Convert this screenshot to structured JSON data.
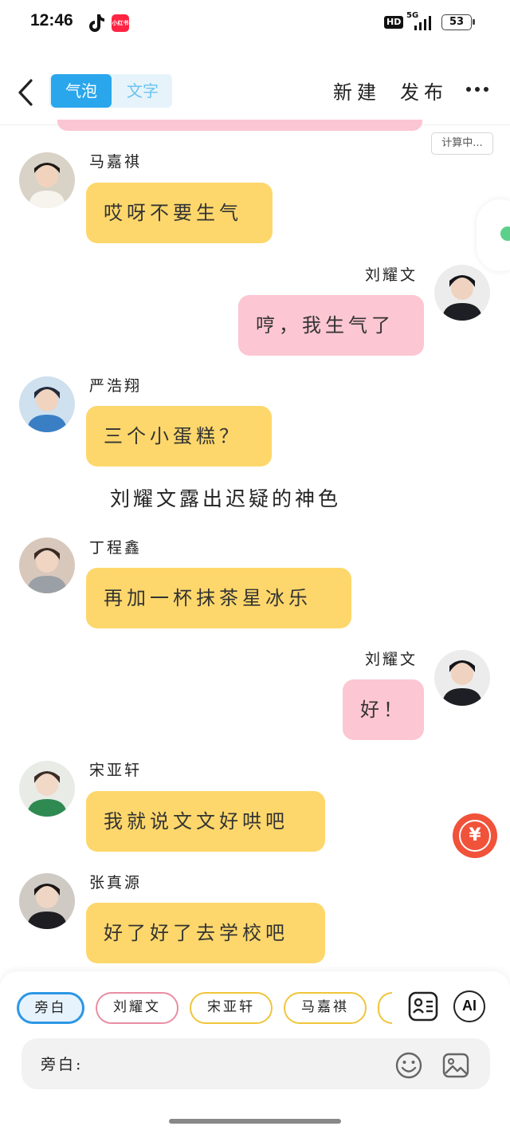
{
  "status_bar": {
    "time": "12:46",
    "xhs_label": "小红书",
    "hd": "HD",
    "network": "5G",
    "battery": "53"
  },
  "header": {
    "mode_bubble": "气泡",
    "mode_text": "文字",
    "new_label": "新建",
    "publish_label": "发布"
  },
  "calc_badge": "计算中...",
  "messages": [
    {
      "speaker": "马嘉祺",
      "text": "哎呀不要生气",
      "side": "left",
      "color": "#fdd76b"
    },
    {
      "speaker": "刘耀文",
      "text": "哼，我生气了",
      "side": "right",
      "color": "#fcc6d2"
    },
    {
      "speaker": "严浩翔",
      "text": "三个小蛋糕？",
      "side": "left",
      "color": "#fdd76b"
    },
    {
      "speaker": "丁程鑫",
      "text": "再加一杯抹茶星冰乐",
      "side": "left",
      "color": "#fdd76b"
    },
    {
      "speaker": "刘耀文",
      "text": "好！",
      "side": "right",
      "color": "#fcc6d2"
    },
    {
      "speaker": "宋亚轩",
      "text": "我就说文文好哄吧",
      "side": "left",
      "color": "#fdd76b"
    },
    {
      "speaker": "张真源",
      "text": "好了好了去学校吧",
      "side": "left",
      "color": "#fdd76b"
    }
  ],
  "narration": "刘耀文露出迟疑的神色",
  "currency_symbol": "¥",
  "composer": {
    "roles": [
      "旁白",
      "刘耀文",
      "宋亚轩",
      "马嘉祺"
    ],
    "ai_label": "AI",
    "input_prefix": "旁白:",
    "input_value": ""
  }
}
